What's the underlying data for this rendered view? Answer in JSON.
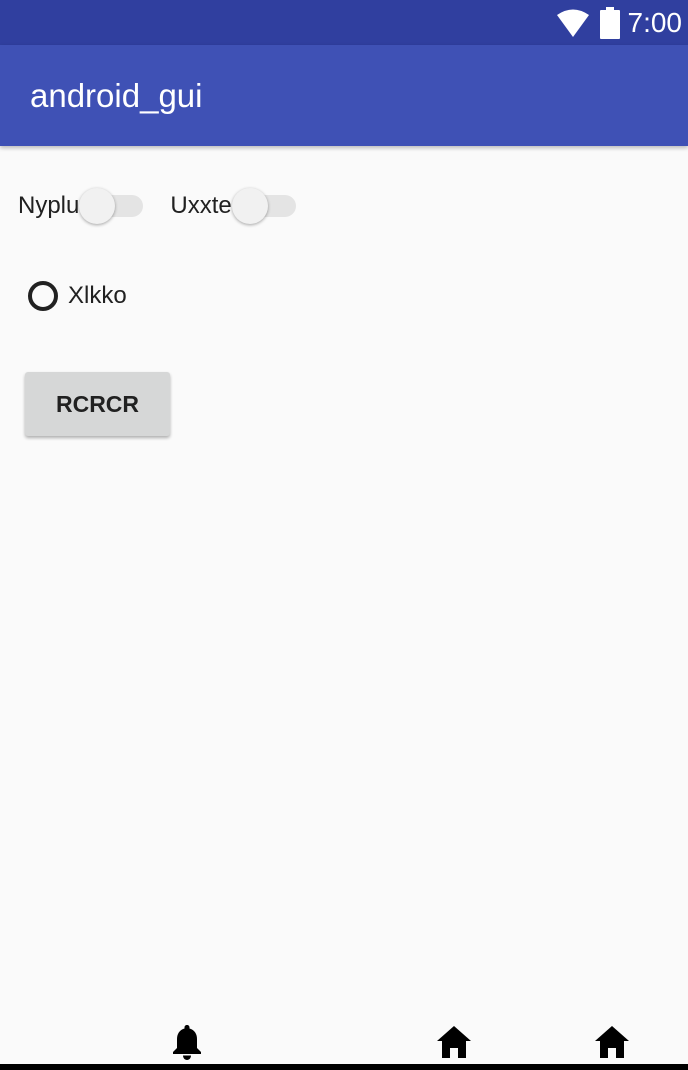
{
  "status_bar": {
    "time": "7:00",
    "icons": [
      "wifi-icon",
      "battery-icon"
    ]
  },
  "app_bar": {
    "title": "android_gui"
  },
  "switches": [
    {
      "label": "Nyplu",
      "checked": false
    },
    {
      "label": "Uxxte",
      "checked": false
    }
  ],
  "radio": {
    "label": "Xlkko",
    "checked": false
  },
  "button": {
    "label": "RCRCR"
  },
  "bottom_icons": [
    "bell-icon",
    "home-icon",
    "home-icon"
  ],
  "colors": {
    "status_bar": "#303f9f",
    "app_bar": "#3f51b5",
    "background": "#fafafa",
    "button": "#d6d7d7"
  }
}
